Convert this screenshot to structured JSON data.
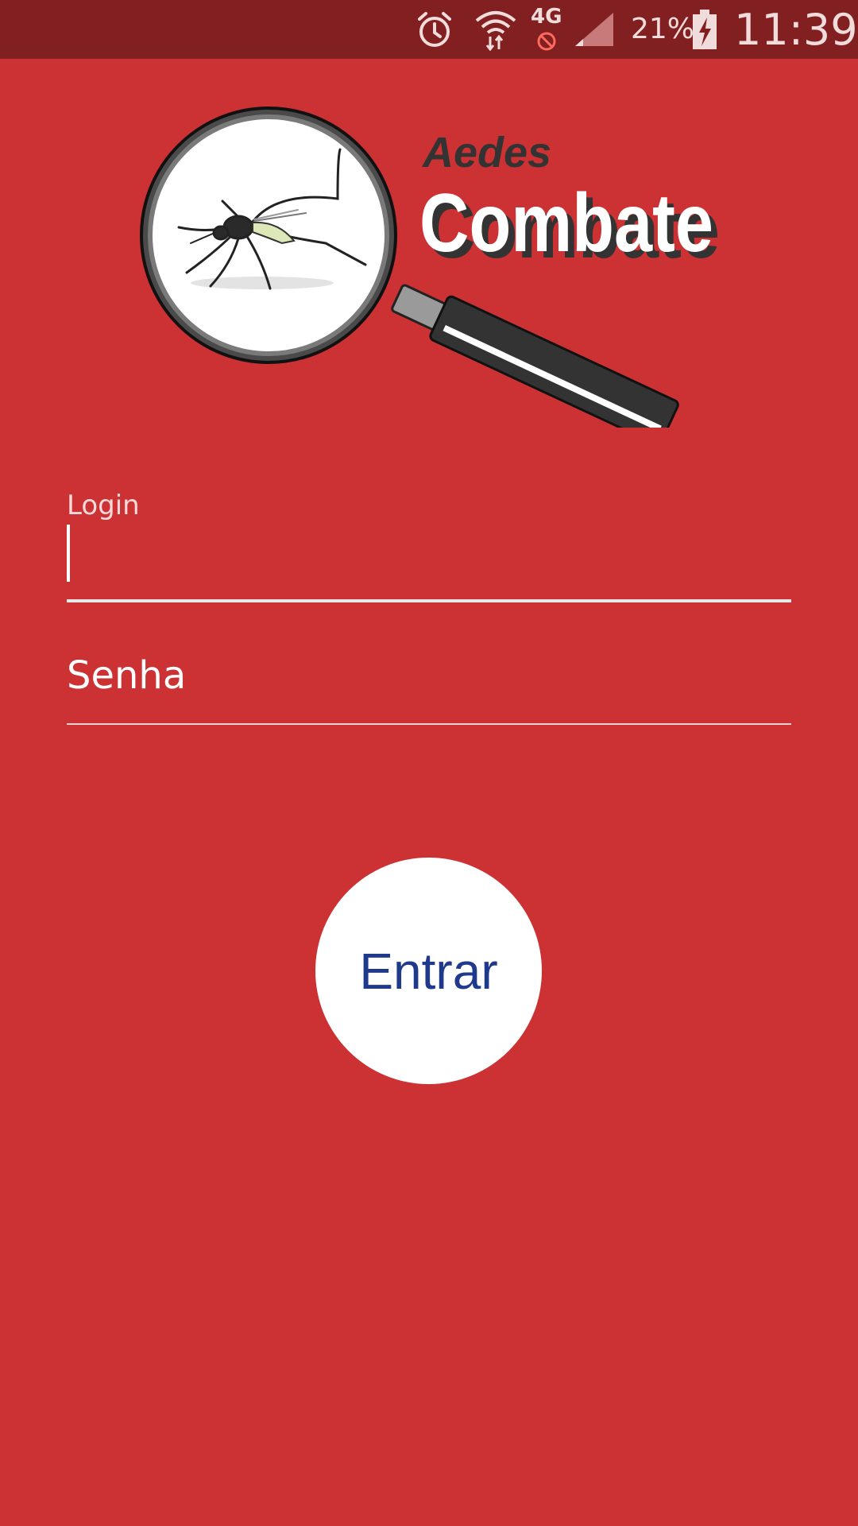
{
  "status_bar": {
    "battery": "21%",
    "time": "11:39",
    "network": "4G",
    "icons": [
      "alarm-icon",
      "wifi-icon",
      "mobile-data-off-icon",
      "signal-icon",
      "battery-charging-icon"
    ]
  },
  "logo": {
    "line1": "Aedes",
    "line2": "Combate",
    "image": "mosquito-magnifying-glass"
  },
  "login_form": {
    "login_label": "Login",
    "login_value": "",
    "password_placeholder": "Senha",
    "submit_label": "Entrar"
  },
  "colors": {
    "background": "#CC3233",
    "status_bar": "#821F21",
    "button": "#FFFFFF",
    "button_text": "#1F3A8C"
  }
}
